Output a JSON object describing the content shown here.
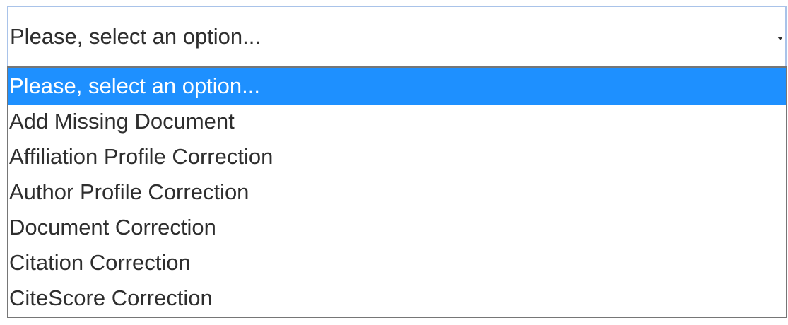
{
  "select": {
    "value": "Please, select an option...",
    "arrow_icon": "caret-down-icon"
  },
  "dropdown": {
    "selected_index": 0,
    "highlight_color": "#1e90ff",
    "options": [
      {
        "label": "Please, select an option..."
      },
      {
        "label": "Add Missing Document"
      },
      {
        "label": "Affiliation Profile Correction"
      },
      {
        "label": "Author Profile Correction"
      },
      {
        "label": "Document Correction"
      },
      {
        "label": "Citation Correction"
      },
      {
        "label": "CiteScore Correction"
      }
    ]
  }
}
